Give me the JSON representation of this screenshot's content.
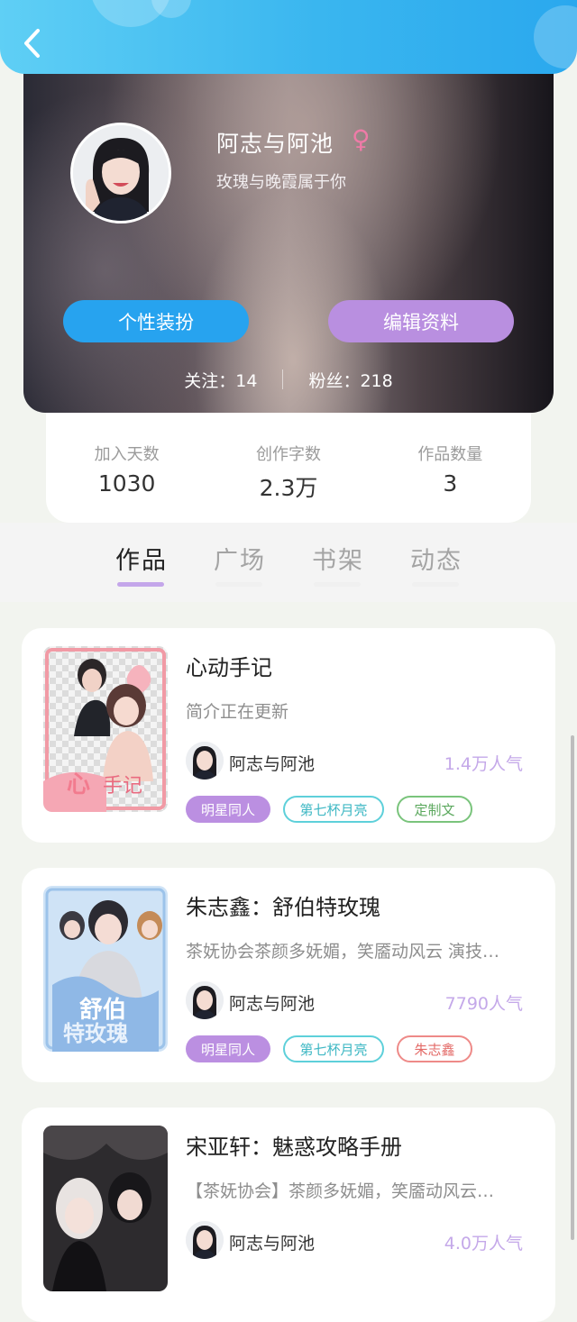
{
  "header": {
    "back_icon": "chevron-left-icon",
    "colors": {
      "gradient_start": "#5fcff5",
      "gradient_end": "#2aa8ee"
    }
  },
  "profile": {
    "name": "阿志与阿池",
    "gender_symbol": "♀",
    "bio": "玫瑰与晚霞属于你",
    "dress_button": "个性装扮",
    "edit_button": "编辑资料",
    "following_label": "关注：",
    "following_count": "14",
    "fans_label": "粉丝：",
    "fans_count": "218"
  },
  "stats": [
    {
      "label": "加入天数",
      "value": "1030"
    },
    {
      "label": "创作字数",
      "value": "2.3万"
    },
    {
      "label": "作品数量",
      "value": "3"
    }
  ],
  "tabs": [
    {
      "label": "作品",
      "active": true
    },
    {
      "label": "广场",
      "active": false
    },
    {
      "label": "书架",
      "active": false
    },
    {
      "label": "动态",
      "active": false
    }
  ],
  "works": [
    {
      "title": "心动手记",
      "desc": "简介正在更新",
      "author": "阿志与阿池",
      "popularity": "1.4万人气",
      "tags": [
        {
          "text": "明星同人",
          "style": "purple"
        },
        {
          "text": "第七杯月亮",
          "style": "cyan"
        },
        {
          "text": "定制文",
          "style": "green"
        }
      ]
    },
    {
      "title": "朱志鑫：舒伯特玫瑰",
      "desc": "茶妩协会茶颜多妩媚，笑靥动风云 演技…",
      "author": "阿志与阿池",
      "popularity": "7790人气",
      "tags": [
        {
          "text": "明星同人",
          "style": "purple"
        },
        {
          "text": "第七杯月亮",
          "style": "cyan"
        },
        {
          "text": "朱志鑫",
          "style": "red"
        }
      ]
    },
    {
      "title": "宋亚轩：魅惑攻略手册",
      "desc": "【茶妩协会】茶颜多妩媚，笑靥动风云…",
      "author": "阿志与阿池",
      "popularity": "4.0万人气",
      "tags": []
    }
  ],
  "colors": {
    "accent_blue": "#27a3ef",
    "accent_purple": "#b98fe0",
    "popularity": "#c4a8e9"
  }
}
